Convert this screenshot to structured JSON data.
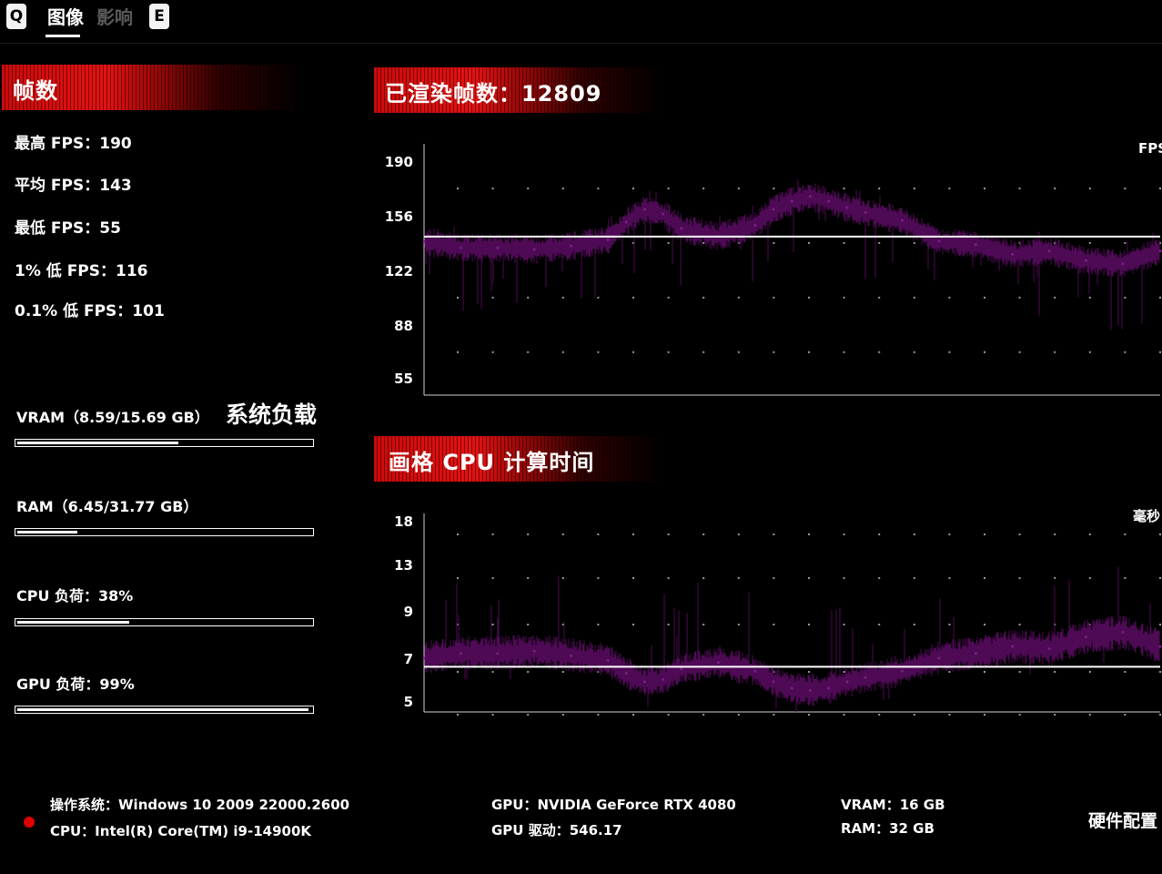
{
  "tabs": {
    "left_key": "Q",
    "right_key": "E",
    "items": [
      {
        "label": "图像",
        "active": true
      },
      {
        "label": "影响",
        "active": false
      }
    ]
  },
  "fps_section": {
    "title": "帧数",
    "stats": [
      "最高 FPS：190",
      "平均 FPS：143",
      "最低 FPS：55",
      "1% 低 FPS：116",
      "0.1% 低 FPS：101"
    ]
  },
  "system_load": {
    "title": "系统负载",
    "items": [
      {
        "label": "VRAM（8.59/15.69 GB）",
        "fraction": 0.547
      },
      {
        "label": "RAM（6.45/31.77 GB）",
        "fraction": 0.203
      },
      {
        "label": "CPU 负荷：38%",
        "fraction": 0.38
      },
      {
        "label": "GPU 负荷：99%",
        "fraction": 0.99
      }
    ]
  },
  "fps_chart": {
    "title": "已渲染帧数：12809",
    "unit": "FPS",
    "y_ticks": [
      "190",
      "156",
      "122",
      "88",
      "55"
    ],
    "colors": {
      "series": "#4e0a55",
      "average_line": "#ffffff"
    }
  },
  "cpu_chart": {
    "title": "画格 CPU 计算时间",
    "unit": "毫秒",
    "y_ticks": [
      "18",
      "13",
      "9",
      "7",
      "5"
    ],
    "colors": {
      "series": "#4e0a55",
      "average_line": "#ffffff"
    }
  },
  "footer": {
    "os": "操作系统：Windows 10 2009 22000.2600",
    "cpu": "CPU：Intel(R) Core(TM) i9-14900K",
    "gpu": "GPU：NVIDIA GeForce RTX 4080",
    "gpu_driver": "GPU 驱动：546.17",
    "vram": "VRAM：16 GB",
    "ram": "RAM：32 GB",
    "hardware_config": "硬件配置"
  },
  "chart_data": [
    {
      "type": "area",
      "title": "已渲染帧数：12809",
      "ylabel": "FPS",
      "ylim": [
        55,
        190
      ],
      "y_ticks": [
        190,
        156,
        122,
        88,
        55
      ],
      "x_range": [
        0,
        12809
      ],
      "average": 143,
      "series": [
        {
          "name": "FPS",
          "x": [
            0,
            640,
            1280,
            1920,
            2560,
            3200,
            3520,
            3840,
            4160,
            4480,
            5120,
            5760,
            6080,
            6400,
            6720,
            7040,
            7360,
            7680,
            8320,
            8960,
            9600,
            10240,
            10880,
            11520,
            12160,
            12809
          ],
          "values": [
            140,
            136,
            136,
            135,
            137,
            141,
            152,
            160,
            157,
            148,
            143,
            150,
            160,
            165,
            168,
            165,
            161,
            158,
            153,
            140,
            138,
            132,
            134,
            128,
            126,
            134
          ]
        }
      ]
    },
    {
      "type": "area",
      "title": "画格 CPU 计算时间",
      "ylabel": "毫秒",
      "y_ticks": [
        18,
        13,
        9,
        7,
        5
      ],
      "x_range": [
        0,
        12809
      ],
      "average": 6.6,
      "series": [
        {
          "name": "毫秒",
          "x": [
            0,
            640,
            1280,
            1920,
            2560,
            3200,
            3520,
            3840,
            4160,
            4480,
            5120,
            5760,
            6080,
            6400,
            6720,
            7040,
            7360,
            7680,
            8320,
            8960,
            9600,
            10240,
            10880,
            11520,
            12160,
            12809
          ],
          "values": [
            7.0,
            7.2,
            7.2,
            7.3,
            7.1,
            6.9,
            6.3,
            5.9,
            6.0,
            6.5,
            6.8,
            6.4,
            5.9,
            5.6,
            5.5,
            5.6,
            5.9,
            6.1,
            6.4,
            7.0,
            7.2,
            7.5,
            7.4,
            7.9,
            8.1,
            7.5
          ]
        }
      ]
    }
  ]
}
